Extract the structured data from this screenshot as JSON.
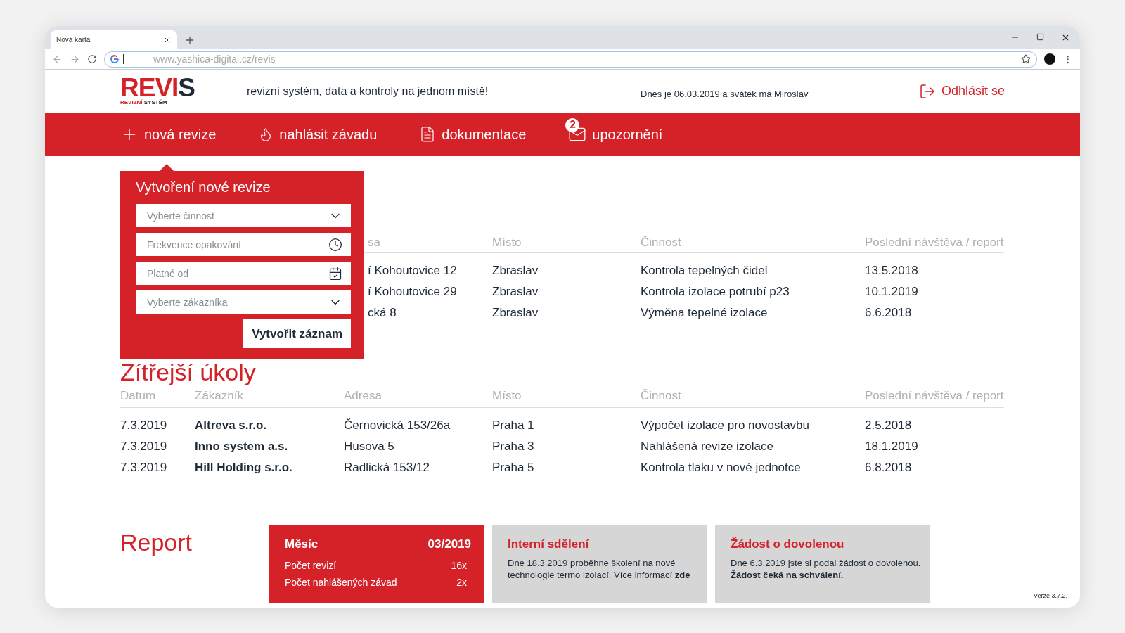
{
  "browser": {
    "tab_title": "Nová karta",
    "url": "www.yashica-digital.cz/revis"
  },
  "header": {
    "logo": {
      "main": "REVI",
      "accent": "S",
      "sub_main": "REVIZNÍ",
      "sub_accent": "SYSTÉM"
    },
    "tagline": "revizní systém, data a kontroly na jednom místě!",
    "date_text": "Dnes je 06.03.2019 a svátek má Miroslav",
    "logout": "Odhlásit se"
  },
  "nav": [
    {
      "label": "nová revize"
    },
    {
      "label": "nahlásit závadu"
    },
    {
      "label": "dokumentace"
    },
    {
      "label": "upozornění",
      "badge": "2"
    }
  ],
  "new_revision_popup": {
    "title": "Vytvoření nové revize",
    "fields": [
      {
        "placeholder": "Vyberte činnost",
        "kind": "select"
      },
      {
        "placeholder": "Frekvence opakování",
        "kind": "recurrence"
      },
      {
        "placeholder": "Platné od",
        "kind": "date"
      },
      {
        "placeholder": "Vyberte zákazníka",
        "kind": "select"
      }
    ],
    "submit": "Vytvořit záznam"
  },
  "today_tasks": {
    "columns": [
      "sa",
      "Místo",
      "Činnost",
      "Poslední návštěva / report"
    ],
    "rows": [
      [
        "í Kohoutovice 12",
        "Zbraslav",
        "Kontrola tepelných čidel",
        "13.5.2018"
      ],
      [
        "í Kohoutovice 29",
        "Zbraslav",
        "Kontrola izolace potrubí p23",
        "10.1.2019"
      ],
      [
        "cká 8",
        "Zbraslav",
        "Výměna tepelné izolace",
        "6.6.2018"
      ]
    ]
  },
  "tomorrow_tasks": {
    "title": "Zítřejší úkoly",
    "columns": [
      "Datum",
      "Zákazník",
      "Adresa",
      "Místo",
      "Činnost",
      "Poslední návštěva / report"
    ],
    "rows": [
      [
        "7.3.2019",
        "Altreva s.r.o.",
        "Černovická 153/26a",
        "Praha 1",
        "Výpočet izolace pro novostavbu",
        "2.5.2018"
      ],
      [
        "7.3.2019",
        "Inno system a.s.",
        "Husova 5",
        "Praha 3",
        "Nahlášená revize izolace",
        "18.1.2019"
      ],
      [
        "7.3.2019",
        "Hill Holding s.r.o.",
        "Radlická 153/12",
        "Praha 5",
        "Kontrola tlaku v nové jednotce",
        "6.8.2018"
      ]
    ]
  },
  "report": {
    "title": "Report",
    "month_card": {
      "label": "Měsíc",
      "value": "03/2019",
      "stats": [
        {
          "label": "Počet revizí",
          "value": "16x"
        },
        {
          "label": "Počet nahlášených závad",
          "value": "2x"
        }
      ]
    },
    "cards": [
      {
        "title": "Interní sdělení",
        "text": "Dne 18.3.2019 proběhne školení na nové technologie termo izolací. Více informací **zde**"
      },
      {
        "title": "Žádost o dovolenou",
        "text": "Dne 6.3.2019 jste si podal žádost o dovolenou. **Žádost čeká na schválení.**"
      }
    ]
  },
  "version": "Verze 3.7.2."
}
